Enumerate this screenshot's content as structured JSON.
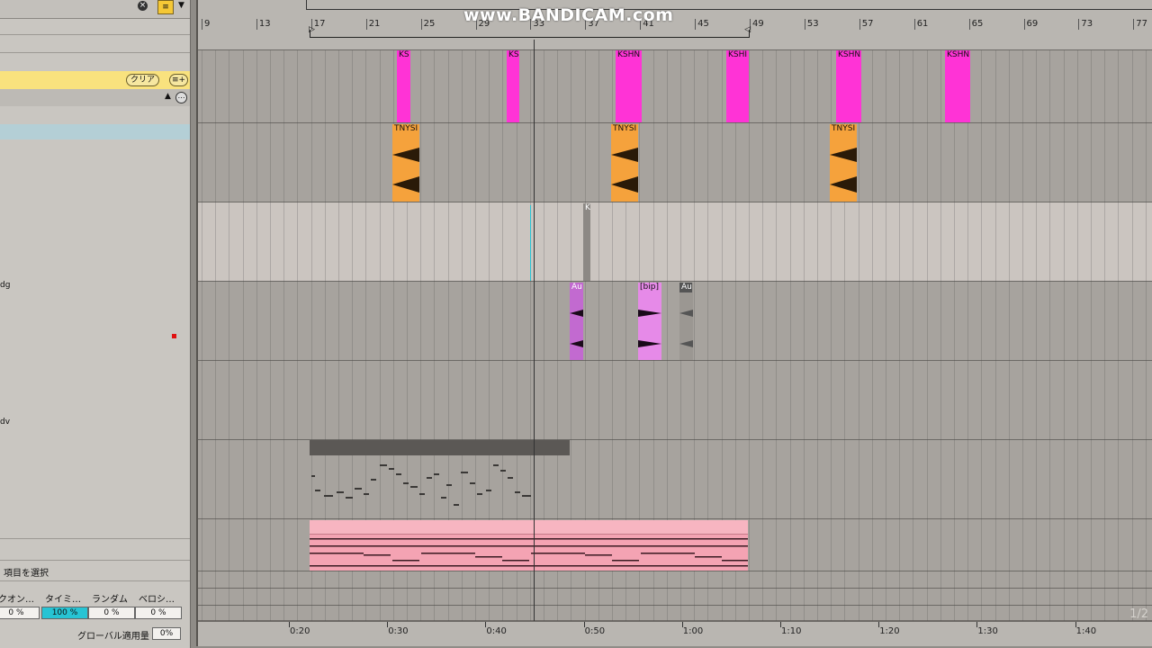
{
  "left_panel": {
    "clear_label": "クリア",
    "groove_add_label": "≡+",
    "track_labels": [
      "dg",
      "dv"
    ],
    "select_item_label": "項目を選択",
    "groove_headers": [
      "クオン…",
      "タイミ…",
      "ランダム",
      "ベロシ…"
    ],
    "groove_values": [
      "0 %",
      "100 %",
      "0 %",
      "0 %"
    ],
    "global_label": "グローバル適用量",
    "global_value": "0%"
  },
  "ruler": {
    "bars": [
      "9",
      "13",
      "17",
      "21",
      "25",
      "29",
      "33",
      "37",
      "41",
      "45",
      "49",
      "53",
      "57",
      "61",
      "65",
      "69",
      "73",
      "77"
    ]
  },
  "time_ruler": {
    "times": [
      "0:20",
      "0:30",
      "0:40",
      "0:50",
      "1:00",
      "1:10",
      "1:20",
      "1:30",
      "1:40"
    ]
  },
  "clips": {
    "kshn": [
      "KS",
      "KS",
      "KSHN",
      "KSHI",
      "KSHN",
      "KSHN"
    ],
    "tnys": [
      "TNYSI",
      "TNYSI",
      "TNYSI"
    ],
    "k_clip": "K",
    "au_clips": [
      "Au",
      "[bip]",
      "Au"
    ]
  },
  "page_number": "1/2",
  "watermark": "www.BANDICAM.com",
  "colors": {
    "magenta": "#ff33d6",
    "orange": "#f5a23c",
    "purple": "#d15fd9",
    "pink": "#f4a3b3",
    "cyan": "#27c4d4",
    "yellow": "#f9e27e"
  }
}
